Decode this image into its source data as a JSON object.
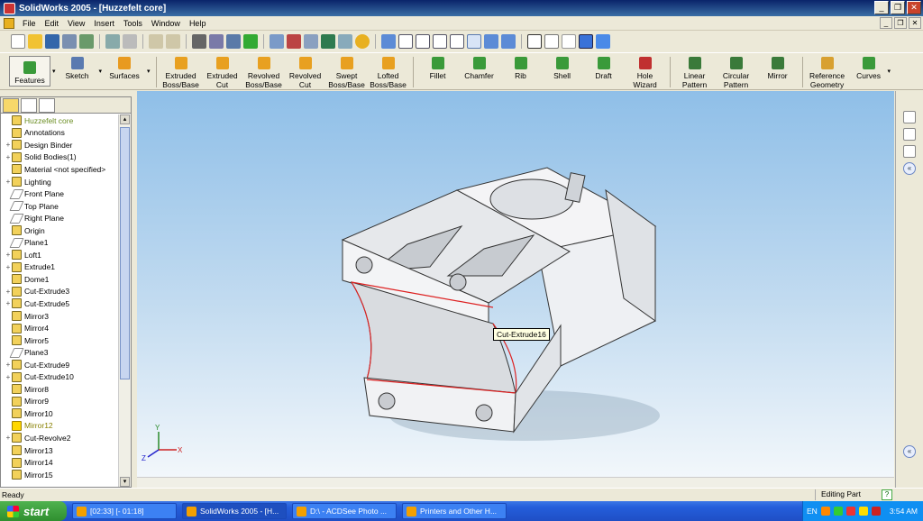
{
  "window": {
    "title": "SolidWorks 2005 - [Huzzefelt core]",
    "buttons": [
      "_",
      "❐",
      "✕"
    ]
  },
  "menu": [
    "File",
    "Edit",
    "View",
    "Insert",
    "Tools",
    "Window",
    "Help"
  ],
  "features_toolbar": {
    "tabs": [
      {
        "label": "Features",
        "icon": "features-icon"
      },
      {
        "label": "Sketch",
        "icon": "sketch-icon"
      },
      {
        "label": "Surfaces",
        "icon": "surfaces-icon"
      }
    ],
    "commands": [
      {
        "line1": "Extruded",
        "line2": "Boss/Base",
        "icon": "extruded-boss-icon"
      },
      {
        "line1": "Extruded",
        "line2": "Cut",
        "icon": "extruded-cut-icon"
      },
      {
        "line1": "Revolved",
        "line2": "Boss/Base",
        "icon": "revolved-boss-icon"
      },
      {
        "line1": "Revolved",
        "line2": "Cut",
        "icon": "revolved-cut-icon"
      },
      {
        "line1": "Swept",
        "line2": "Boss/Base",
        "icon": "swept-boss-icon"
      },
      {
        "line1": "Lofted",
        "line2": "Boss/Base",
        "icon": "lofted-boss-icon"
      },
      {
        "line1": "Fillet",
        "line2": "",
        "icon": "fillet-icon"
      },
      {
        "line1": "Chamfer",
        "line2": "",
        "icon": "chamfer-icon"
      },
      {
        "line1": "Rib",
        "line2": "",
        "icon": "rib-icon"
      },
      {
        "line1": "Shell",
        "line2": "",
        "icon": "shell-icon"
      },
      {
        "line1": "Draft",
        "line2": "",
        "icon": "draft-icon"
      },
      {
        "line1": "Hole",
        "line2": "Wizard",
        "icon": "hole-wizard-icon"
      },
      {
        "line1": "Linear",
        "line2": "Pattern",
        "icon": "linear-pattern-icon"
      },
      {
        "line1": "Circular",
        "line2": "Pattern",
        "icon": "circular-pattern-icon"
      },
      {
        "line1": "Mirror",
        "line2": "",
        "icon": "mirror-icon"
      },
      {
        "line1": "Reference",
        "line2": "Geometry",
        "icon": "reference-geometry-icon"
      },
      {
        "line1": "Curves",
        "line2": "",
        "icon": "curves-icon"
      }
    ]
  },
  "feature_tree": {
    "items": [
      {
        "label": "Huzzefelt core",
        "icon": "part-icon",
        "kind": "root"
      },
      {
        "label": "Annotations",
        "icon": "annotations-icon",
        "kind": "normal"
      },
      {
        "label": "Design Binder",
        "icon": "design-binder-icon",
        "kind": "normal"
      },
      {
        "label": "Solid Bodies(1)",
        "icon": "solid-bodies-icon",
        "kind": "normal"
      },
      {
        "label": "Material <not specified>",
        "icon": "material-icon",
        "kind": "normal"
      },
      {
        "label": "Lighting",
        "icon": "lighting-icon",
        "kind": "normal"
      },
      {
        "label": "Front Plane",
        "icon": "plane-icon",
        "kind": "plane"
      },
      {
        "label": "Top Plane",
        "icon": "plane-icon",
        "kind": "plane"
      },
      {
        "label": "Right Plane",
        "icon": "plane-icon",
        "kind": "plane"
      },
      {
        "label": "Origin",
        "icon": "origin-icon",
        "kind": "normal"
      },
      {
        "label": "Plane1",
        "icon": "plane-icon",
        "kind": "plane"
      },
      {
        "label": "Loft1",
        "icon": "loft-icon",
        "kind": "normal"
      },
      {
        "label": "Extrude1",
        "icon": "extrude-icon",
        "kind": "normal"
      },
      {
        "label": "Dome1",
        "icon": "dome-icon",
        "kind": "normal"
      },
      {
        "label": "Cut-Extrude3",
        "icon": "cut-extrude-icon",
        "kind": "normal"
      },
      {
        "label": "Cut-Extrude5",
        "icon": "cut-extrude-icon",
        "kind": "normal"
      },
      {
        "label": "Mirror3",
        "icon": "mirror-icon",
        "kind": "normal"
      },
      {
        "label": "Mirror4",
        "icon": "mirror-icon",
        "kind": "normal"
      },
      {
        "label": "Mirror5",
        "icon": "mirror-icon",
        "kind": "normal"
      },
      {
        "label": "Plane3",
        "icon": "plane-icon",
        "kind": "plane"
      },
      {
        "label": "Cut-Extrude9",
        "icon": "cut-extrude-icon",
        "kind": "normal"
      },
      {
        "label": "Cut-Extrude10",
        "icon": "cut-extrude-icon",
        "kind": "normal"
      },
      {
        "label": "Mirror8",
        "icon": "mirror-icon",
        "kind": "normal"
      },
      {
        "label": "Mirror9",
        "icon": "mirror-icon",
        "kind": "normal"
      },
      {
        "label": "Mirror10",
        "icon": "mirror-icon",
        "kind": "normal"
      },
      {
        "label": "Mirror12",
        "icon": "mirror-icon",
        "kind": "warn"
      },
      {
        "label": "Cut-Revolve2",
        "icon": "cut-revolve-icon",
        "kind": "normal"
      },
      {
        "label": "Mirror13",
        "icon": "mirror-icon",
        "kind": "normal"
      },
      {
        "label": "Mirror14",
        "icon": "mirror-icon",
        "kind": "normal"
      },
      {
        "label": "Mirror15",
        "icon": "mirror-icon",
        "kind": "normal"
      }
    ]
  },
  "viewport": {
    "tooltip": "Cut-Extrude16",
    "triad": {
      "x": "X",
      "y": "Y",
      "z": "Z"
    }
  },
  "status": {
    "left": "Ready",
    "right": "Editing Part",
    "help": "?"
  },
  "taskbar": {
    "start_label": "start",
    "tasks": [
      {
        "label": "[02:33] [- 01:18]",
        "icon": "media-player-icon",
        "active": false
      },
      {
        "label": "SolidWorks 2005 - [H...",
        "icon": "solidworks-icon",
        "active": true
      },
      {
        "label": "D:\\ - ACDSee Photo ...",
        "icon": "acdsee-icon",
        "active": false
      },
      {
        "label": "Printers and Other H...",
        "icon": "printers-icon",
        "active": false
      }
    ],
    "tray": {
      "lang": "EN",
      "time": "3:54 AM"
    }
  }
}
